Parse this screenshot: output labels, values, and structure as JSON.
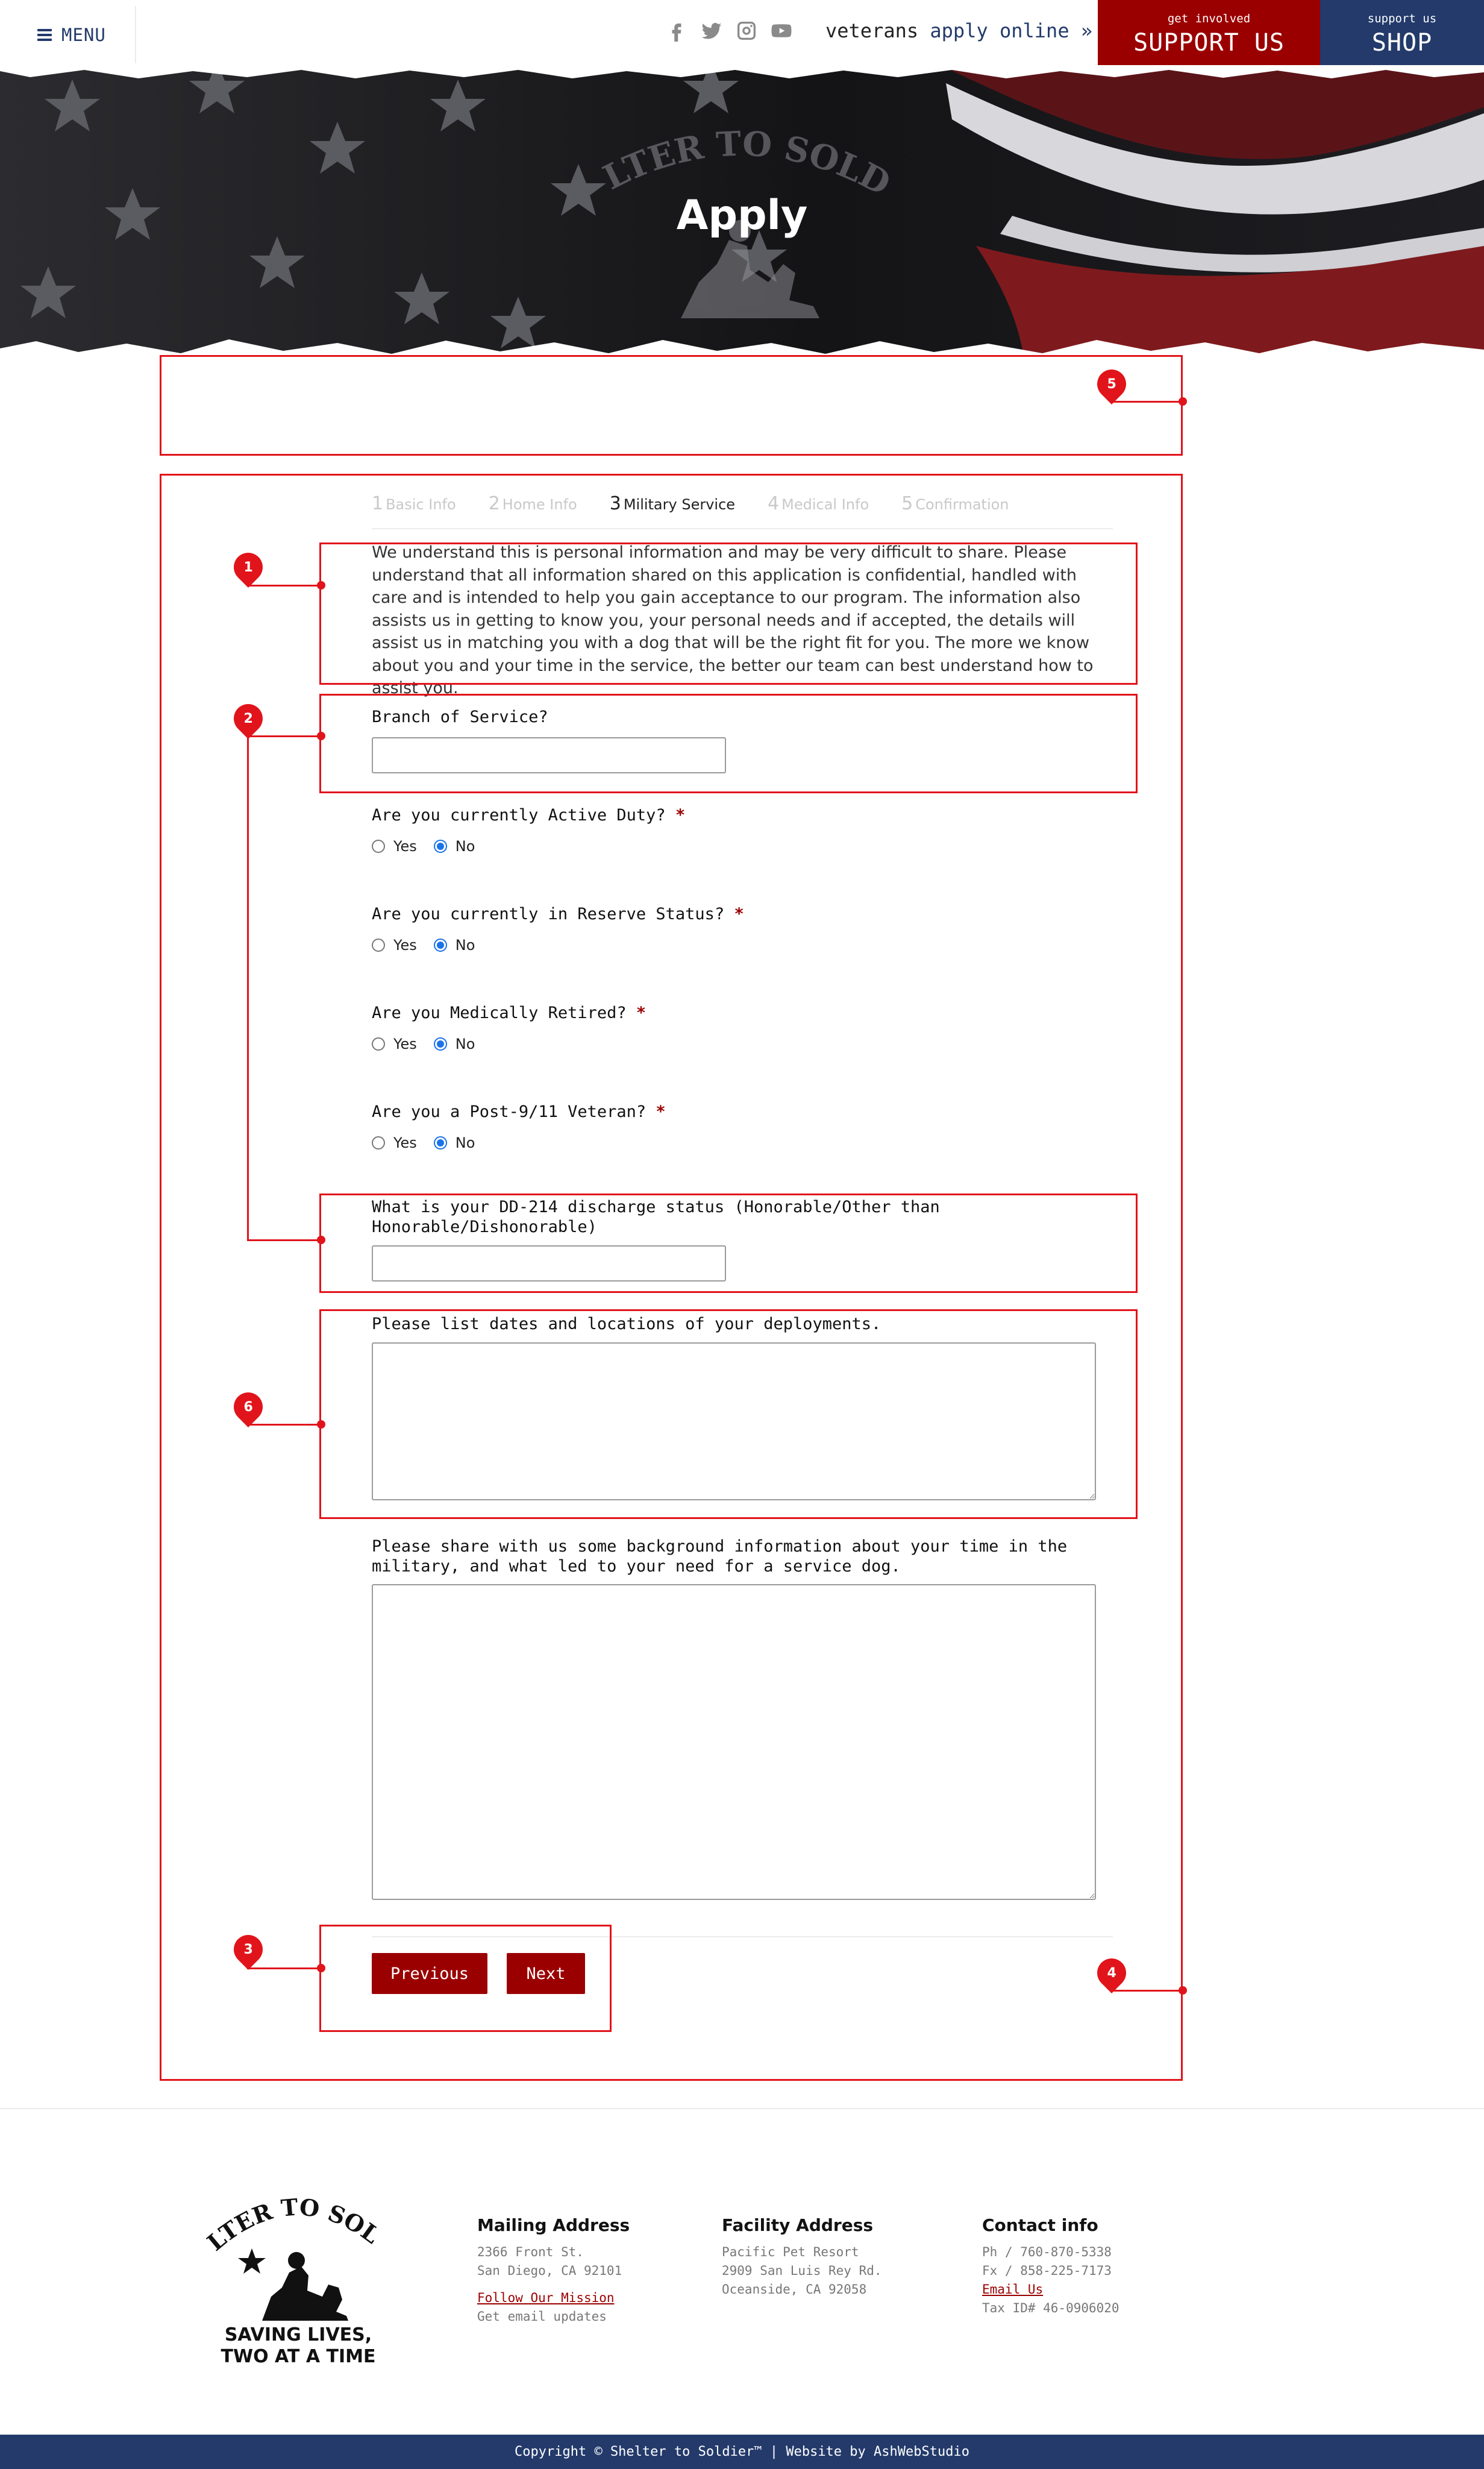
{
  "header": {
    "menu_label": "MENU",
    "socials": [
      "facebook-icon",
      "twitter-icon",
      "instagram-icon",
      "youtube-icon"
    ],
    "apply_prefix": "veterans",
    "apply_link": "apply online »",
    "support_small": "get involved",
    "support_big": "SUPPORT US",
    "shop_small": "support us",
    "shop_big": "SHOP"
  },
  "hero": {
    "title": "Apply",
    "logo_text": "SHELTER TO SOLDIER"
  },
  "form": {
    "steps": [
      {
        "num": "1",
        "label": "Basic Info"
      },
      {
        "num": "2",
        "label": "Home Info"
      },
      {
        "num": "3",
        "label": "Military Service"
      },
      {
        "num": "4",
        "label": "Medical Info"
      },
      {
        "num": "5",
        "label": "Confirmation"
      }
    ],
    "active_step": 3,
    "intro": "We understand this is personal information and may be very difficult to share. Please understand that all information shared on this application is confidential, handled with care and is intended to help you gain acceptance to our program. The information also assists us in getting to know you, your personal needs and if accepted, the details will assist us in matching you with a dog that will be the right fit for you. The more we know about you and your time in the service, the better our team can best understand how to assist you.",
    "branch_label": "Branch of Service?",
    "branch_value": "",
    "required_mark": "*",
    "radio_questions": [
      {
        "label": "Are you currently Active Duty?",
        "yes": "Yes",
        "no": "No",
        "selected": "No"
      },
      {
        "label": "Are you currently in Reserve Status?",
        "yes": "Yes",
        "no": "No",
        "selected": "No"
      },
      {
        "label": "Are you Medically Retired?",
        "yes": "Yes",
        "no": "No",
        "selected": "No"
      },
      {
        "label": "Are you a Post-9/11 Veteran?",
        "yes": "Yes",
        "no": "No",
        "selected": "No"
      }
    ],
    "dd214_label_line1": "What is your DD-214 discharge status (Honorable/Other than",
    "dd214_label_line2": "Honorable/Dishonorable)",
    "dd214_value": "",
    "deployments_label": "Please list dates and locations of your deployments.",
    "deployments_value": "",
    "background_label_line1": "Please share with us some background information about your time in the",
    "background_label_line2": "military, and what led to your need for a service dog.",
    "background_value": "",
    "previous_label": "Previous",
    "next_label": "Next"
  },
  "annotations": [
    "1",
    "2",
    "3",
    "4",
    "5",
    "6"
  ],
  "footer": {
    "logo_text": "SHELTER TO SOLDIER",
    "tagline_line1": "SAVING LIVES,",
    "tagline_line2": "TWO AT A TIME",
    "mailing": {
      "title": "Mailing Address",
      "line1": "2366 Front St.",
      "line2": "San Diego, CA 92101",
      "link": "Follow Our Mission",
      "extra": "Get email updates"
    },
    "facility": {
      "title": "Facility Address",
      "line1": "Pacific Pet Resort",
      "line2": "2909 San Luis Rey Rd.",
      "line3": "Oceanside, CA 92058"
    },
    "contact": {
      "title": "Contact info",
      "phone": "Ph / 760-870-5338",
      "fax": "Fx / 858-225-7173",
      "email": "Email Us",
      "tax": "Tax ID# 46-0906020"
    },
    "copyright": "Copyright © Shelter to Soldier™ | Website by AshWebStudio"
  },
  "colors": {
    "brand_red": "#9b0000",
    "brand_navy": "#233a6b",
    "annotation_red": "#e1141b",
    "radio_blue": "#1a73e8"
  }
}
